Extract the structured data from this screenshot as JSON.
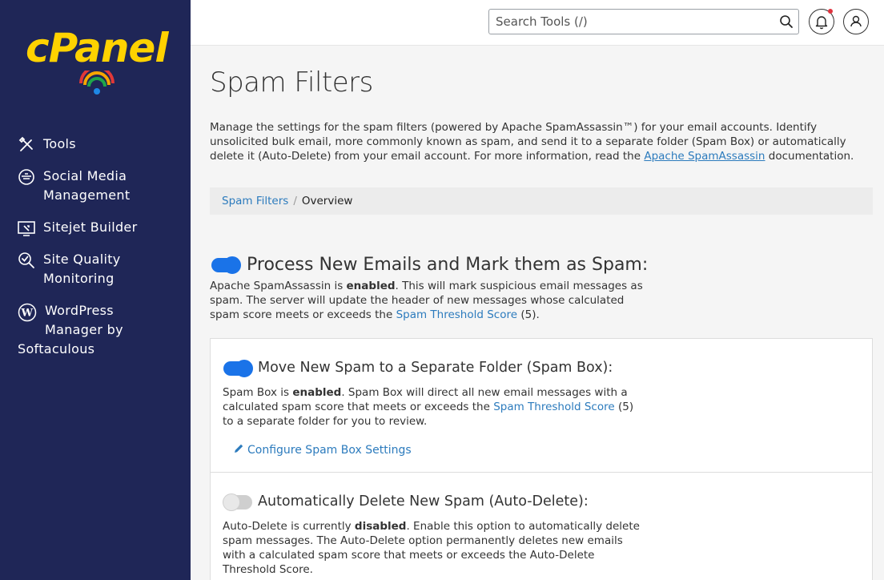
{
  "sidebar": {
    "logo_text": "cPanel",
    "items": [
      {
        "label": "Tools",
        "icon": "tools-icon"
      },
      {
        "label": "Social Media\nManagement",
        "icon": "social-media-icon"
      },
      {
        "label": "Sitejet Builder",
        "icon": "sitejet-icon"
      },
      {
        "label": "Site Quality\nMonitoring",
        "icon": "site-quality-icon"
      },
      {
        "label": "WordPress\nManager by",
        "label2": "Softaculous",
        "icon": "wordpress-icon"
      }
    ]
  },
  "header": {
    "search_placeholder": "Search Tools (/)"
  },
  "page": {
    "title": "Spam Filters",
    "intro_text": "Manage the settings for the spam filters (powered by Apache SpamAssassin™) for your email accounts. Identify unsolicited bulk email, more commonly known as spam, and send it to a separate folder (Spam Box) or automatically delete it (Auto-Delete) from your email account. For more information, read the ",
    "intro_link": "Apache SpamAssassin",
    "intro_suffix": " documentation."
  },
  "breadcrumb": {
    "link": "Spam Filters",
    "separator": "/",
    "current": "Overview"
  },
  "process": {
    "title": "Process New Emails and Mark them as Spam:",
    "desc_pre": "Apache SpamAssassin is ",
    "desc_bold": "enabled",
    "desc_mid": ". This will mark suspicious email messages as spam. The server will update the header of new messages whose calculated spam score meets or exceeds the ",
    "desc_link": "Spam Threshold Score",
    "desc_post": " (5).",
    "enabled": true
  },
  "spambox": {
    "title": "Move New Spam to a Separate Folder (Spam Box):",
    "desc_pre": "Spam Box is ",
    "desc_bold": "enabled",
    "desc_mid": ". Spam Box will direct all new email messages with a calculated spam score that meets or exceeds the ",
    "desc_link": "Spam Threshold Score",
    "desc_post": " (5) to a separate folder for you to review.",
    "config_link": "Configure Spam Box Settings",
    "enabled": true
  },
  "autodelete": {
    "title": "Automatically Delete New Spam (Auto-Delete):",
    "desc_pre": "Auto-Delete is currently ",
    "desc_bold": "disabled",
    "desc_post": ". Enable this option to automatically delete spam messages. The Auto-Delete option permanently deletes new emails with a calculated spam score that meets or exceeds the Auto-Delete Threshold Score.",
    "enabled": false
  },
  "colors": {
    "sidebar_bg": "#1f2657",
    "logo": "#ffd200",
    "link": "#2c7bbd",
    "toggle_on": "#1a73e8"
  }
}
